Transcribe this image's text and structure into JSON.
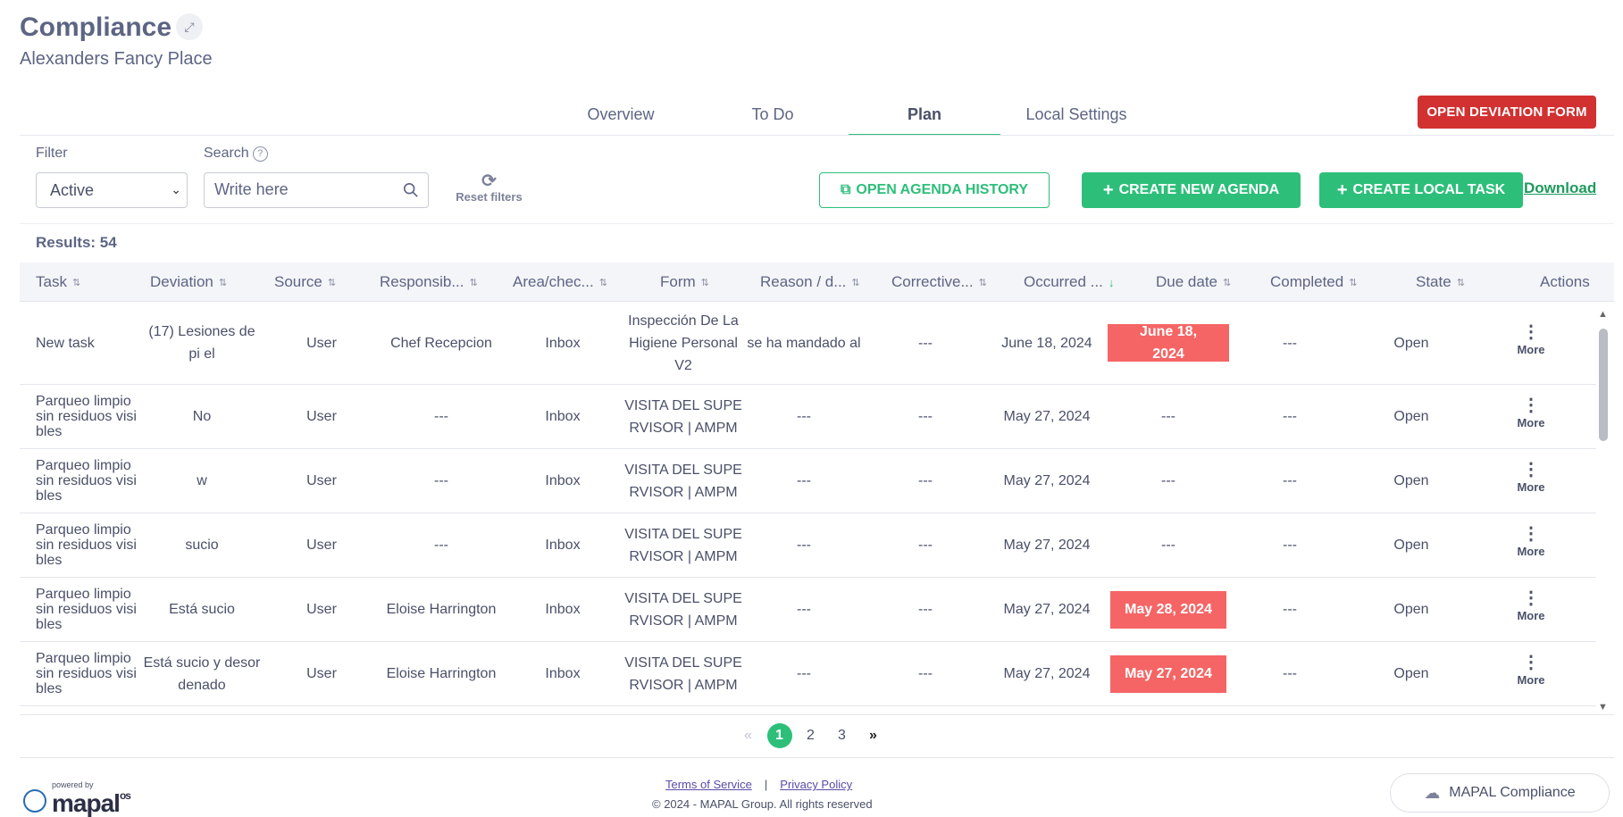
{
  "header": {
    "title": "Compliance",
    "subtitle": "Alexanders Fancy Place",
    "expand_icon": "↗↙"
  },
  "tabs": [
    {
      "label": "Overview",
      "active": false
    },
    {
      "label": "To Do",
      "active": false
    },
    {
      "label": "Plan",
      "active": true
    },
    {
      "label": "Local Settings",
      "active": false
    }
  ],
  "actions": {
    "open_deviation_form": "OPEN DEVIATION FORM",
    "open_agenda_history": "OPEN AGENDA HISTORY",
    "create_new_agenda": "CREATE NEW AGENDA",
    "create_local_task": "CREATE LOCAL TASK",
    "download": "Download"
  },
  "filters": {
    "filter_label": "Filter",
    "filter_value": "Active",
    "search_label": "Search",
    "search_placeholder": "Write here",
    "reset_label": "Reset filters"
  },
  "results_label": "Results: 54",
  "table": {
    "columns": [
      "Task",
      "Deviation",
      "Source",
      "Responsib...",
      "Area/chec...",
      "Form",
      "Reason / d...",
      "Corrective...",
      "Occurred ...",
      "Due date",
      "Completed",
      "State",
      "Actions"
    ],
    "rows": [
      {
        "task": "New task",
        "deviation": "(17) Lesiones de pi el",
        "source": "User",
        "responsible": "Chef Recepcion",
        "area": "Inbox",
        "form": "Inspección De La Higiene Personal V2",
        "reason": "se ha mandado al",
        "corrective": "---",
        "occurred": "June 18, 2024",
        "due": "June 18, 2024",
        "due_overdue": true,
        "completed": "---",
        "state": "Open",
        "action": "More"
      },
      {
        "task": "Parqueo limpio sin residuos visi bles",
        "deviation": "No",
        "source": "User",
        "responsible": "---",
        "area": "Inbox",
        "form": "VISITA DEL SUPE RVISOR | AMPM",
        "reason": "---",
        "corrective": "---",
        "occurred": "May 27, 2024",
        "due": "---",
        "due_overdue": false,
        "completed": "---",
        "state": "Open",
        "action": "More"
      },
      {
        "task": "Parqueo limpio sin residuos visi bles",
        "deviation": "w",
        "source": "User",
        "responsible": "---",
        "area": "Inbox",
        "form": "VISITA DEL SUPE RVISOR | AMPM",
        "reason": "---",
        "corrective": "---",
        "occurred": "May 27, 2024",
        "due": "---",
        "due_overdue": false,
        "completed": "---",
        "state": "Open",
        "action": "More"
      },
      {
        "task": "Parqueo limpio sin residuos visi bles",
        "deviation": "sucio",
        "source": "User",
        "responsible": "---",
        "area": "Inbox",
        "form": "VISITA DEL SUPE RVISOR | AMPM",
        "reason": "---",
        "corrective": "---",
        "occurred": "May 27, 2024",
        "due": "---",
        "due_overdue": false,
        "completed": "---",
        "state": "Open",
        "action": "More"
      },
      {
        "task": "Parqueo limpio sin residuos visi bles",
        "deviation": "Está sucio",
        "source": "User",
        "responsible": "Eloise Harrington",
        "area": "Inbox",
        "form": "VISITA DEL SUPE RVISOR | AMPM",
        "reason": "---",
        "corrective": "---",
        "occurred": "May 27, 2024",
        "due": "May 28, 2024",
        "due_overdue": true,
        "completed": "---",
        "state": "Open",
        "action": "More"
      },
      {
        "task": "Parqueo limpio sin residuos visi bles",
        "deviation": "Está sucio y desor denado",
        "source": "User",
        "responsible": "Eloise Harrington",
        "area": "Inbox",
        "form": "VISITA DEL SUPE RVISOR | AMPM",
        "reason": "---",
        "corrective": "---",
        "occurred": "May 27, 2024",
        "due": "May 27, 2024",
        "due_overdue": true,
        "completed": "---",
        "state": "Open",
        "action": "More"
      }
    ]
  },
  "pagination": {
    "prev": "«",
    "pages": [
      "1",
      "2",
      "3"
    ],
    "current": "1",
    "next": "»"
  },
  "footer": {
    "powered_by": "powered by",
    "brand": "mapal",
    "brand_suffix": "os",
    "terms": "Terms of Service",
    "separator": "|",
    "privacy": "Privacy Policy",
    "copyright": "© 2024 - MAPAL Group. All rights reserved",
    "product_button": "MAPAL Compliance"
  },
  "colors": {
    "accent_green": "#2dbf7a",
    "danger_red": "#d23131",
    "overdue_badge": "#f56565",
    "text": "#4a5068"
  }
}
